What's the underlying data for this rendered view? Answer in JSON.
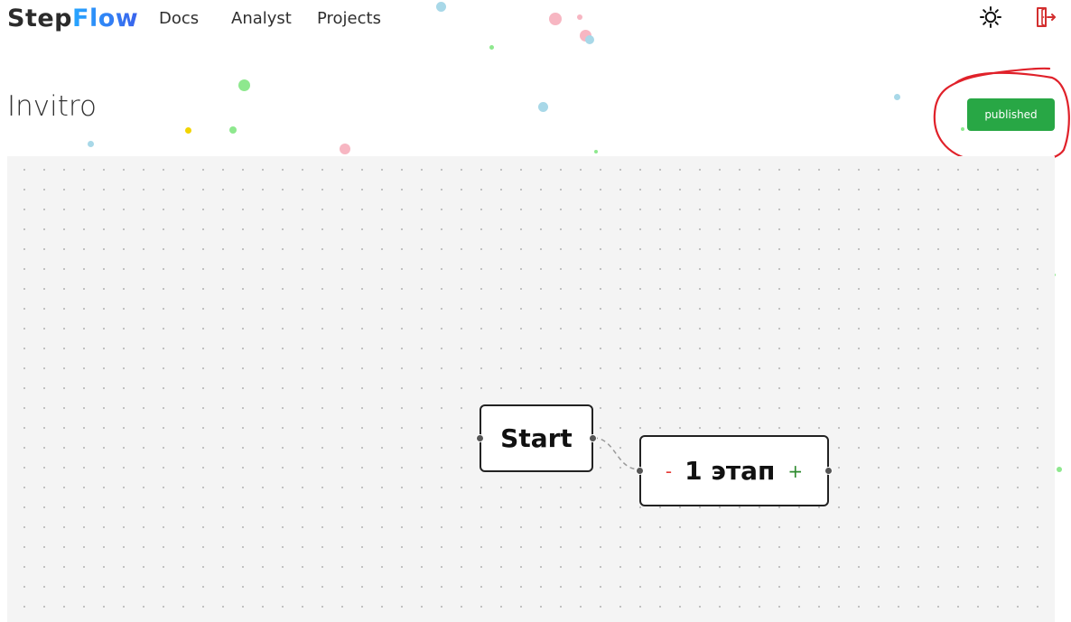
{
  "app": {
    "logo_part1": "Step",
    "logo_part2": "Flow"
  },
  "nav": {
    "docs": "Docs",
    "analyst": "Analyst",
    "projects": "Projects"
  },
  "header_icons": {
    "theme": "sun-icon",
    "logout": "logout-door-icon"
  },
  "page": {
    "title": "Invitro",
    "status_label": "published"
  },
  "flow": {
    "nodes": [
      {
        "id": "start",
        "label": "Start"
      },
      {
        "id": "stage-1",
        "label": "1 этап",
        "remove_symbol": "-",
        "add_symbol": "+"
      }
    ],
    "edges": [
      {
        "from": "start",
        "to": "stage-1",
        "style": "dashed"
      }
    ]
  },
  "colors": {
    "status_green": "#28a745",
    "annotation_red": "#e0212a",
    "logo_gradient_start": "#27a6ff",
    "logo_gradient_end": "#3a63ec",
    "logout_red": "#d32f2f",
    "canvas_bg": "#f4f4f4",
    "stage_minus": "#e53935",
    "stage_plus": "#2e8b2e"
  }
}
